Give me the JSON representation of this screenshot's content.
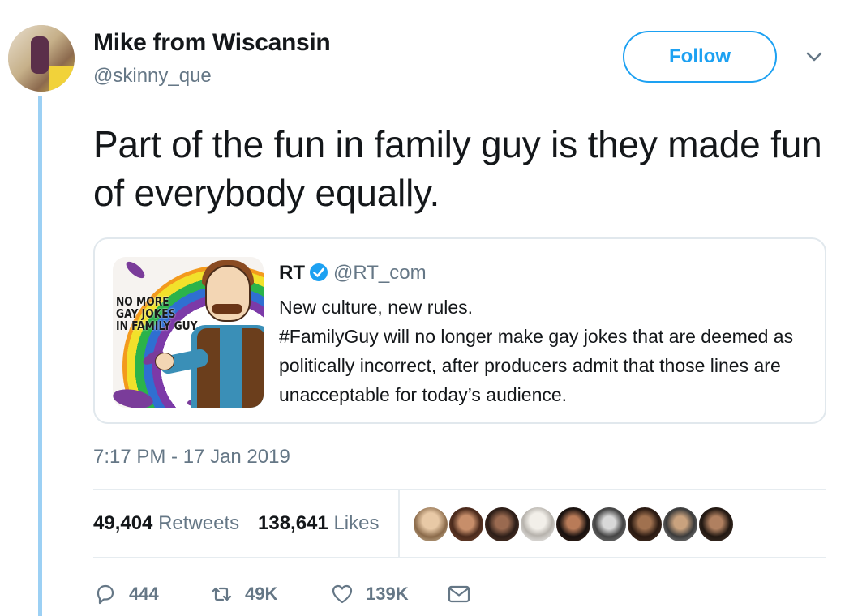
{
  "author": {
    "name": "Mike from Wiscansin",
    "handle": "@skinny_que"
  },
  "follow_label": "Follow",
  "tweet_text": "Part of the fun in family guy is they made fun of everybody equally.",
  "quoted": {
    "name": "RT",
    "handle": "@RT_com",
    "text": "New culture, new rules.\n#FamilyGuy will no longer make gay jokes that are deemed as politically incorrect, after producers admit that those lines are unacceptable for today’s audience.",
    "image_lines": [
      "NO MORE",
      "GAY JOKES",
      "IN FAMILY GUY"
    ]
  },
  "timestamp": "7:17 PM - 17 Jan 2019",
  "stats": {
    "retweets_count": "49,404",
    "retweets_label": "Retweets",
    "likes_count": "138,641",
    "likes_label": "Likes"
  },
  "actions": {
    "replies": "444",
    "retweets": "49K",
    "likes": "139K"
  },
  "colors": {
    "accent": "#1da1f2",
    "thread_line": "#9cd0f4",
    "muted": "#657786"
  }
}
